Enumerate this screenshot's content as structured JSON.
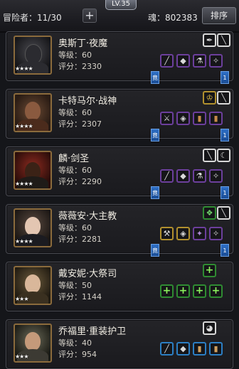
{
  "topbar": {
    "heroes_label": "冒险者：11/30",
    "add_label": "+",
    "level_label": "LV.35",
    "soul_label": "魂：802383",
    "sort_label": "排序"
  },
  "stars": "★★★★",
  "stars3": "★★★",
  "heroes": [
    {
      "name": "奥斯丁·夜魔",
      "level": "等级：60",
      "score": "评分：2330",
      "flag_label": "竟",
      "flag2_label": "1"
    },
    {
      "name": "卡特马尔·战神",
      "level": "等级：60",
      "score": "评分：2307",
      "flag_label": "竟",
      "flag2_label": "1"
    },
    {
      "name": "麟·剑圣",
      "level": "等级：60",
      "score": "评分：2290",
      "flag_label": "竟",
      "flag2_label": "1"
    },
    {
      "name": "薇薇安·大主教",
      "level": "等级：60",
      "score": "评分：2281",
      "flag_label": "竟",
      "flag2_label": "1"
    },
    {
      "name": "戴安妮·大祭司",
      "level": "等级：50",
      "score": "评分：1144"
    },
    {
      "name": "乔福里·重装护卫",
      "level": "等级：40",
      "score": "评分：954"
    }
  ],
  "icons": {
    "skill": "skill-icon",
    "equipment": "equipment-icon",
    "add_slot": "plus-icon"
  }
}
